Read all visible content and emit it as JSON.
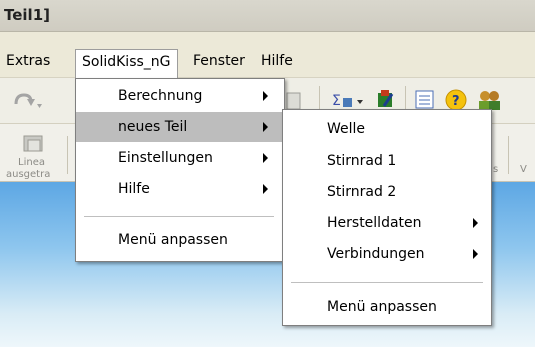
{
  "window": {
    "title": "Teil1]"
  },
  "menubar": {
    "items": [
      "Extras",
      "SolidKiss_nG",
      "Fenster",
      "Hilfe"
    ],
    "active_index": 1
  },
  "toolbar": {
    "partial_labels": {
      "linear_label_top": "Linea",
      "linear_label_bottom": "ausgetra",
      "right_s": "s",
      "right_v": "V"
    }
  },
  "menu_solidkiss": {
    "items": [
      "Berechnung",
      "neues Teil",
      "Einstellungen",
      "Hilfe"
    ],
    "footer": "Menü anpassen"
  },
  "menu_neues_teil": {
    "items": [
      "Welle",
      "Stirnrad 1",
      "Stirnrad 2",
      "Herstelldaten",
      "Verbindungen"
    ],
    "footer": "Menü anpassen"
  }
}
